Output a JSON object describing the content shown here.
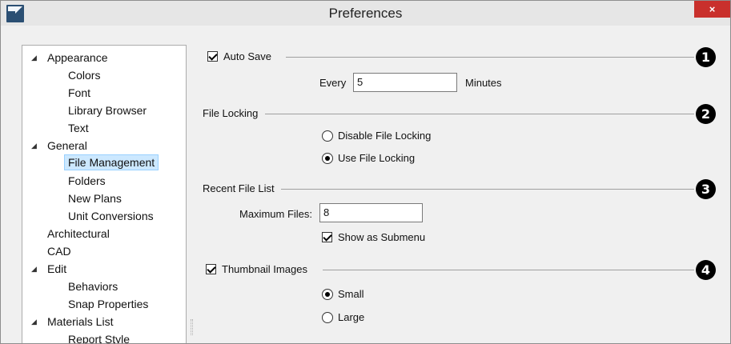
{
  "window": {
    "title": "Preferences",
    "close_glyph": "×",
    "app_icon": "chief-architect-logo-icon"
  },
  "tree": {
    "expander_glyph": "◢",
    "items": [
      {
        "label": "Appearance",
        "level": 0,
        "expanded": true
      },
      {
        "label": "Colors",
        "level": 1
      },
      {
        "label": "Font",
        "level": 1
      },
      {
        "label": "Library Browser",
        "level": 1
      },
      {
        "label": "Text",
        "level": 1
      },
      {
        "label": "General",
        "level": 0,
        "expanded": true
      },
      {
        "label": "File Management",
        "level": 1,
        "selected": true
      },
      {
        "label": "Folders",
        "level": 1
      },
      {
        "label": "New Plans",
        "level": 1
      },
      {
        "label": "Unit Conversions",
        "level": 1
      },
      {
        "label": "Architectural",
        "level": 0
      },
      {
        "label": "CAD",
        "level": 0
      },
      {
        "label": "Edit",
        "level": 0,
        "expanded": true
      },
      {
        "label": "Behaviors",
        "level": 1
      },
      {
        "label": "Snap Properties",
        "level": 1
      },
      {
        "label": "Materials List",
        "level": 0,
        "expanded": true
      },
      {
        "label": "Report Style",
        "level": 1
      }
    ]
  },
  "auto_save": {
    "label": "Auto Save",
    "checked": true,
    "every_label": "Every",
    "every_value": "5",
    "minutes_label": "Minutes",
    "callout": "1"
  },
  "file_locking": {
    "label": "File Locking",
    "disable_label": "Disable File Locking",
    "use_label": "Use File Locking",
    "selected": "use",
    "callout": "2"
  },
  "recent_files": {
    "label": "Recent File List",
    "max_label": "Maximum Files:",
    "max_value": "8",
    "submenu_label": "Show as Submenu",
    "submenu_checked": true,
    "callout": "3"
  },
  "thumbnails": {
    "label": "Thumbnail Images",
    "checked": true,
    "small_label": "Small",
    "large_label": "Large",
    "selected": "small",
    "callout": "4"
  },
  "colors": {
    "close_button": "#c9302c",
    "selection_bg": "#cce8ff",
    "selection_border": "#99d1ff"
  }
}
